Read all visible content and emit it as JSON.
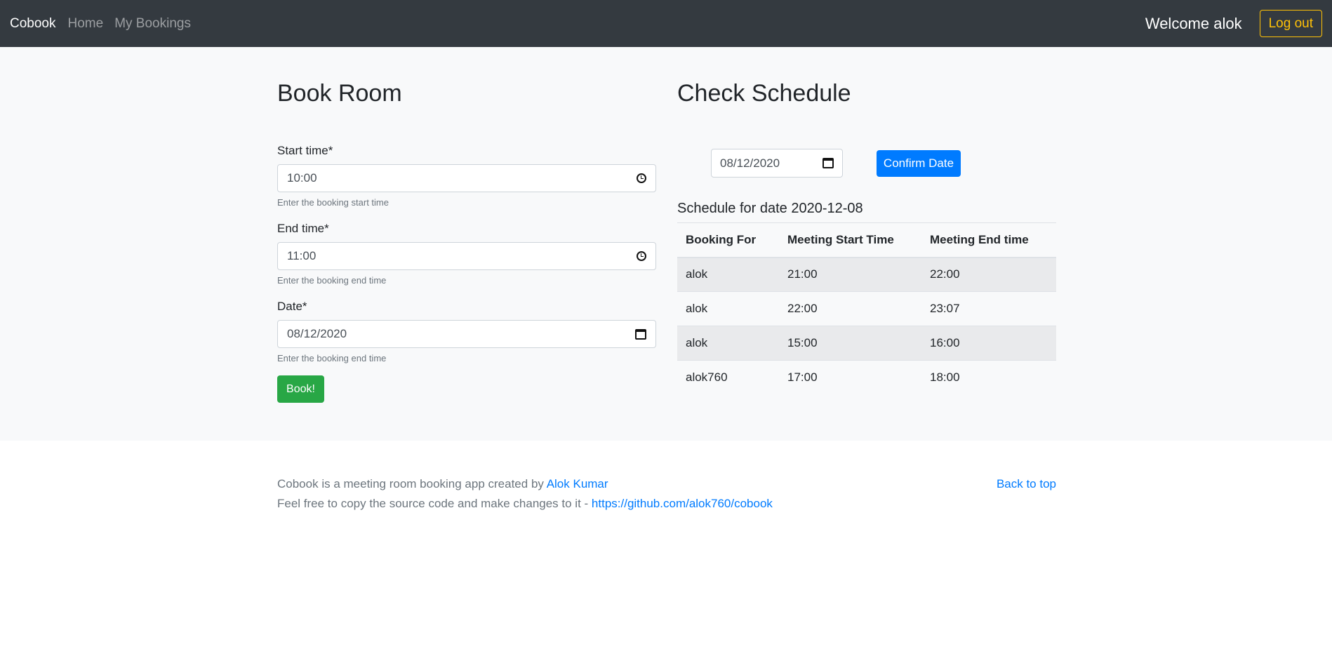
{
  "navbar": {
    "brand": "Cobook",
    "links": [
      "Home",
      "My Bookings"
    ],
    "welcome": "Welcome alok",
    "logout_label": "Log out"
  },
  "book_room": {
    "title": "Book Room",
    "start_time": {
      "label": "Start time*",
      "value": "10:00",
      "help": "Enter the booking start time"
    },
    "end_time": {
      "label": "End time*",
      "value": "11:00",
      "help": "Enter the booking end time"
    },
    "date": {
      "label": "Date*",
      "value": "08/12/2020",
      "help": "Enter the booking end time"
    },
    "book_label": "Book!"
  },
  "check_schedule": {
    "title": "Check Schedule",
    "date_value": "08/12/2020",
    "confirm_label": "Confirm Date",
    "schedule_title": "Schedule for date 2020-12-08",
    "columns": [
      "Booking For",
      "Meeting Start Time",
      "Meeting End time"
    ],
    "rows": [
      [
        "alok",
        "21:00",
        "22:00"
      ],
      [
        "alok",
        "22:00",
        "23:07"
      ],
      [
        "alok",
        "15:00",
        "16:00"
      ],
      [
        "alok760",
        "17:00",
        "18:00"
      ]
    ]
  },
  "footer": {
    "line1_text": "Cobook is a meeting room booking app created by ",
    "author_link": "Alok Kumar",
    "line2_text": "Feel free to copy the source code and make changes to it - ",
    "repo_link": "https://github.com/alok760/cobook",
    "back_to_top": "Back to top"
  },
  "colors": {
    "navbar_bg": "#343a40",
    "main_bg": "#f8f9fa",
    "success": "#28a745",
    "primary": "#007bff",
    "warning": "#ffc107"
  }
}
